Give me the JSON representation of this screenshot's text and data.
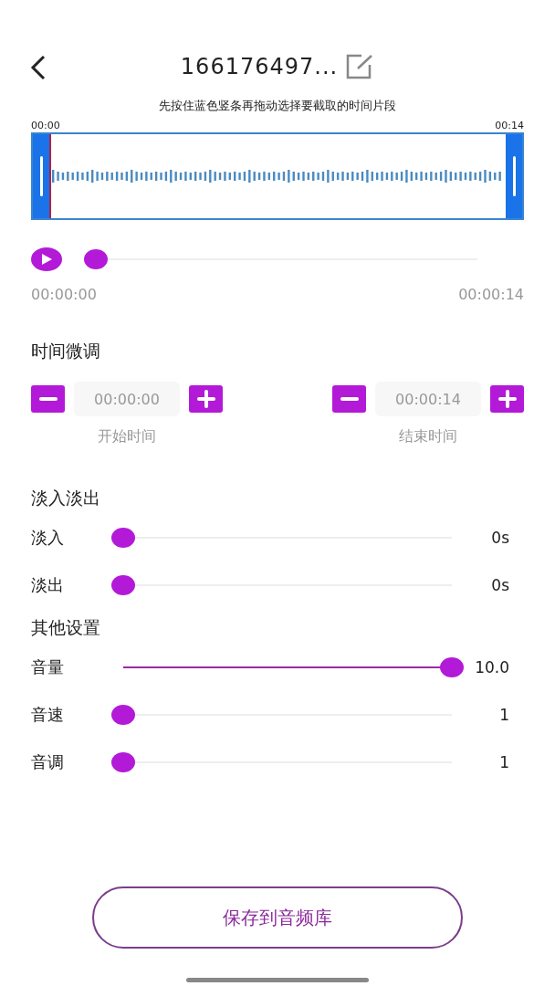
{
  "header": {
    "title": "166176497..."
  },
  "trim": {
    "hint": "先按住蓝色竖条再拖动选择要截取的时间片段",
    "start_label": "00:00",
    "end_label": "00:14"
  },
  "player": {
    "level": 0,
    "current": "00:00:00",
    "total": "00:00:14"
  },
  "fine_tune": {
    "title": "时间微调",
    "fields": [
      {
        "value": "00:00:00",
        "caption": "开始时间"
      },
      {
        "value": "00:00:14",
        "caption": "结束时间"
      }
    ]
  },
  "fade": {
    "title": "淡入淡出",
    "sliders": [
      {
        "label": "淡入",
        "level": 0,
        "reading": "0s"
      },
      {
        "label": "淡出",
        "level": 0,
        "reading": "0s"
      }
    ]
  },
  "other": {
    "title": "其他设置",
    "sliders": [
      {
        "label": "音量",
        "level": 1,
        "reading": "10.0"
      },
      {
        "label": "音速",
        "level": 0,
        "reading": "1"
      },
      {
        "label": "音调",
        "level": 0,
        "reading": "1"
      }
    ]
  },
  "save_button": "保存到音频库"
}
